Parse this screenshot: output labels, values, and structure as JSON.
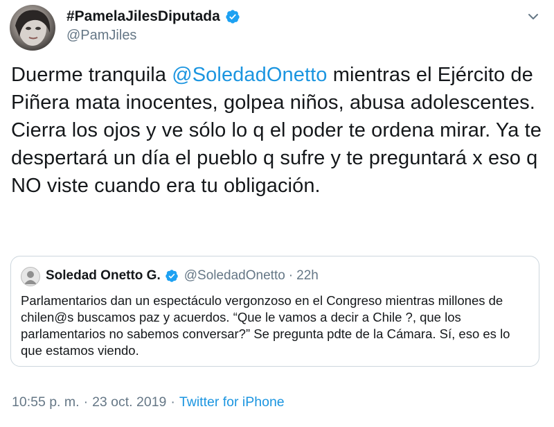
{
  "author": {
    "display_name": "#PamelaJilesDiputada",
    "handle": "@PamJiles"
  },
  "tweet": {
    "text_before": "Duerme tranquila ",
    "mention": "@SoledadOnetto",
    "text_after": " mientras el Ejército de Piñera mata inocentes, golpea niños, abusa adolescentes. Cierra los ojos y ve sólo lo q el poder te ordena mirar. Ya te despertará un día el pueblo q sufre y te preguntará x eso q NO viste cuando era tu obligación."
  },
  "quoted": {
    "name": "Soledad Onetto G.",
    "handle": "@SoledadOnetto",
    "separator": "·",
    "time": "22h",
    "text": "Parlamentarios dan un espectáculo vergonzoso en el Congreso mientras millones de chilen@s buscamos paz y acuerdos. “Que le vamos a decir a Chile ?, que los parlamentarios no sabemos conversar?” Se pregunta pdte de la Cámara. Sí, eso es lo que estamos viendo."
  },
  "footer": {
    "time": "10:55 p. m.",
    "separator": "·",
    "date": "23 oct. 2019",
    "separator2": "·",
    "source": "Twitter for iPhone"
  },
  "icons": {
    "verified": "verified-badge-icon",
    "menu": "chevron-down-icon"
  },
  "colors": {
    "accent": "#1b95e0",
    "verified": "#1da1f2",
    "secondary_text": "#657786",
    "primary_text": "#14171a",
    "border": "#ccd6dd"
  }
}
